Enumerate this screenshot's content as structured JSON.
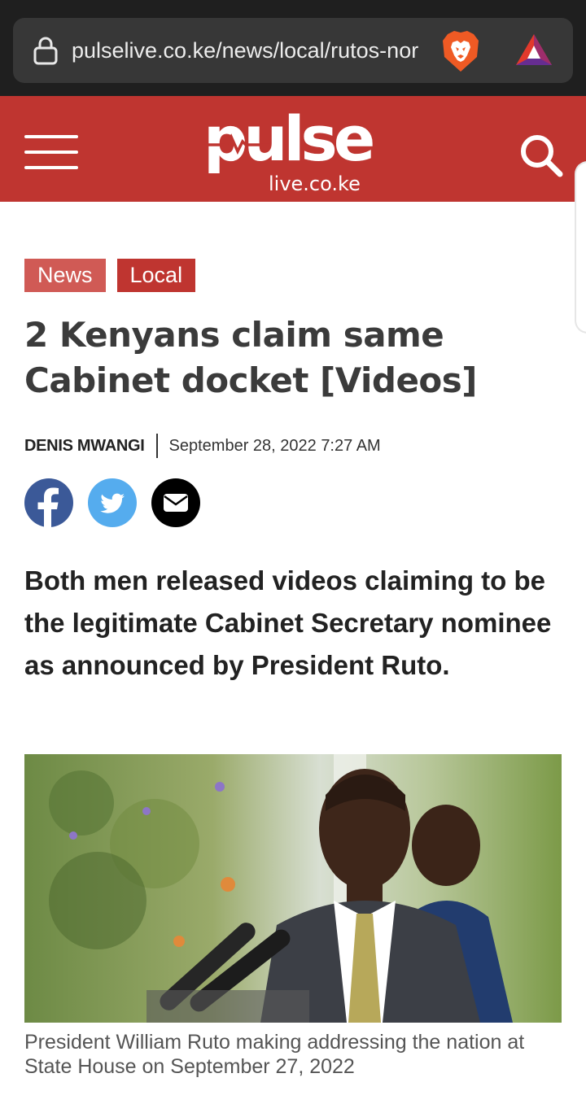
{
  "browser": {
    "url": "pulselive.co.ke/news/local/rutos-nor"
  },
  "site": {
    "logo_word": "pulse",
    "logo_domain": "live.co.ke"
  },
  "article": {
    "tags": [
      "News",
      "Local"
    ],
    "headline": "2 Kenyans claim same Cabinet docket [Videos]",
    "author": "DENIS MWANGI",
    "date": "September 28, 2022 7:27 AM",
    "lead": "Both men released videos claiming to be the legitimate Cabinet Secretary nominee as announced by President Ruto.",
    "image_caption": "President William Ruto making addressing the nation at State House on September 27, 2022"
  },
  "share": {
    "icons": [
      "facebook-icon",
      "twitter-icon",
      "email-icon"
    ]
  },
  "colors": {
    "brand_red": "#bf3530",
    "news_tag": "#d05a55",
    "facebook": "#3b5998",
    "twitter": "#55acee",
    "browser_bg": "#1f1f1f",
    "url_box": "#373737"
  }
}
